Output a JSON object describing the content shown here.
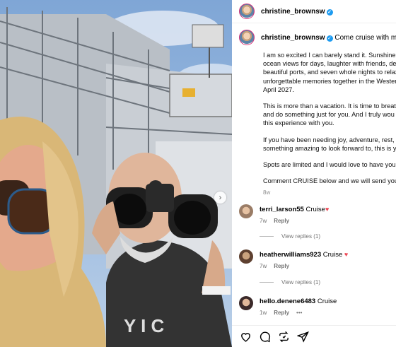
{
  "post": {
    "username": "christine_brownsw",
    "caption_title": "Come cruise with me!",
    "caption_paragraphs": [
      [
        "I am so excited I can barely stand it. Sunshine c",
        "ocean views for days, laughter with friends, del",
        "beautiful ports, and seven whole nights to relax",
        "unforgettable memories together in the Wester",
        "April 2027."
      ],
      [
        "This is more than a vacation. It is time to breath",
        "and do something just for you. And I truly wou",
        "this experience with you."
      ],
      [
        "If you have been needing joy, adventure, rest, o",
        "something amazing to look forward to, this is y"
      ],
      [
        "Spots are limited and I would love to have you"
      ],
      [
        "Comment CRUISE below and we will send you"
      ]
    ],
    "age": "8w"
  },
  "comments": [
    {
      "user": "terri_larson55",
      "text": "Cruise",
      "heart": true,
      "age": "7w",
      "reply": "Reply",
      "view_replies": "View replies (1)"
    },
    {
      "user": "heatherwilliams923",
      "text": "Cruise",
      "heart": true,
      "age": "7w",
      "reply": "Reply",
      "view_replies": "View replies (1)"
    },
    {
      "user": "hello.denene6483",
      "text": "Cruise",
      "heart": false,
      "age": "1w",
      "reply": "Reply",
      "more": "•••"
    }
  ],
  "icons": [
    "verified-badge-icon",
    "heart-icon",
    "comment-icon",
    "repost-icon",
    "share-icon",
    "chevron-right-icon"
  ],
  "colors": {
    "verified": "#1d9bf0",
    "heart": "#ed4956",
    "muted": "#737373"
  }
}
